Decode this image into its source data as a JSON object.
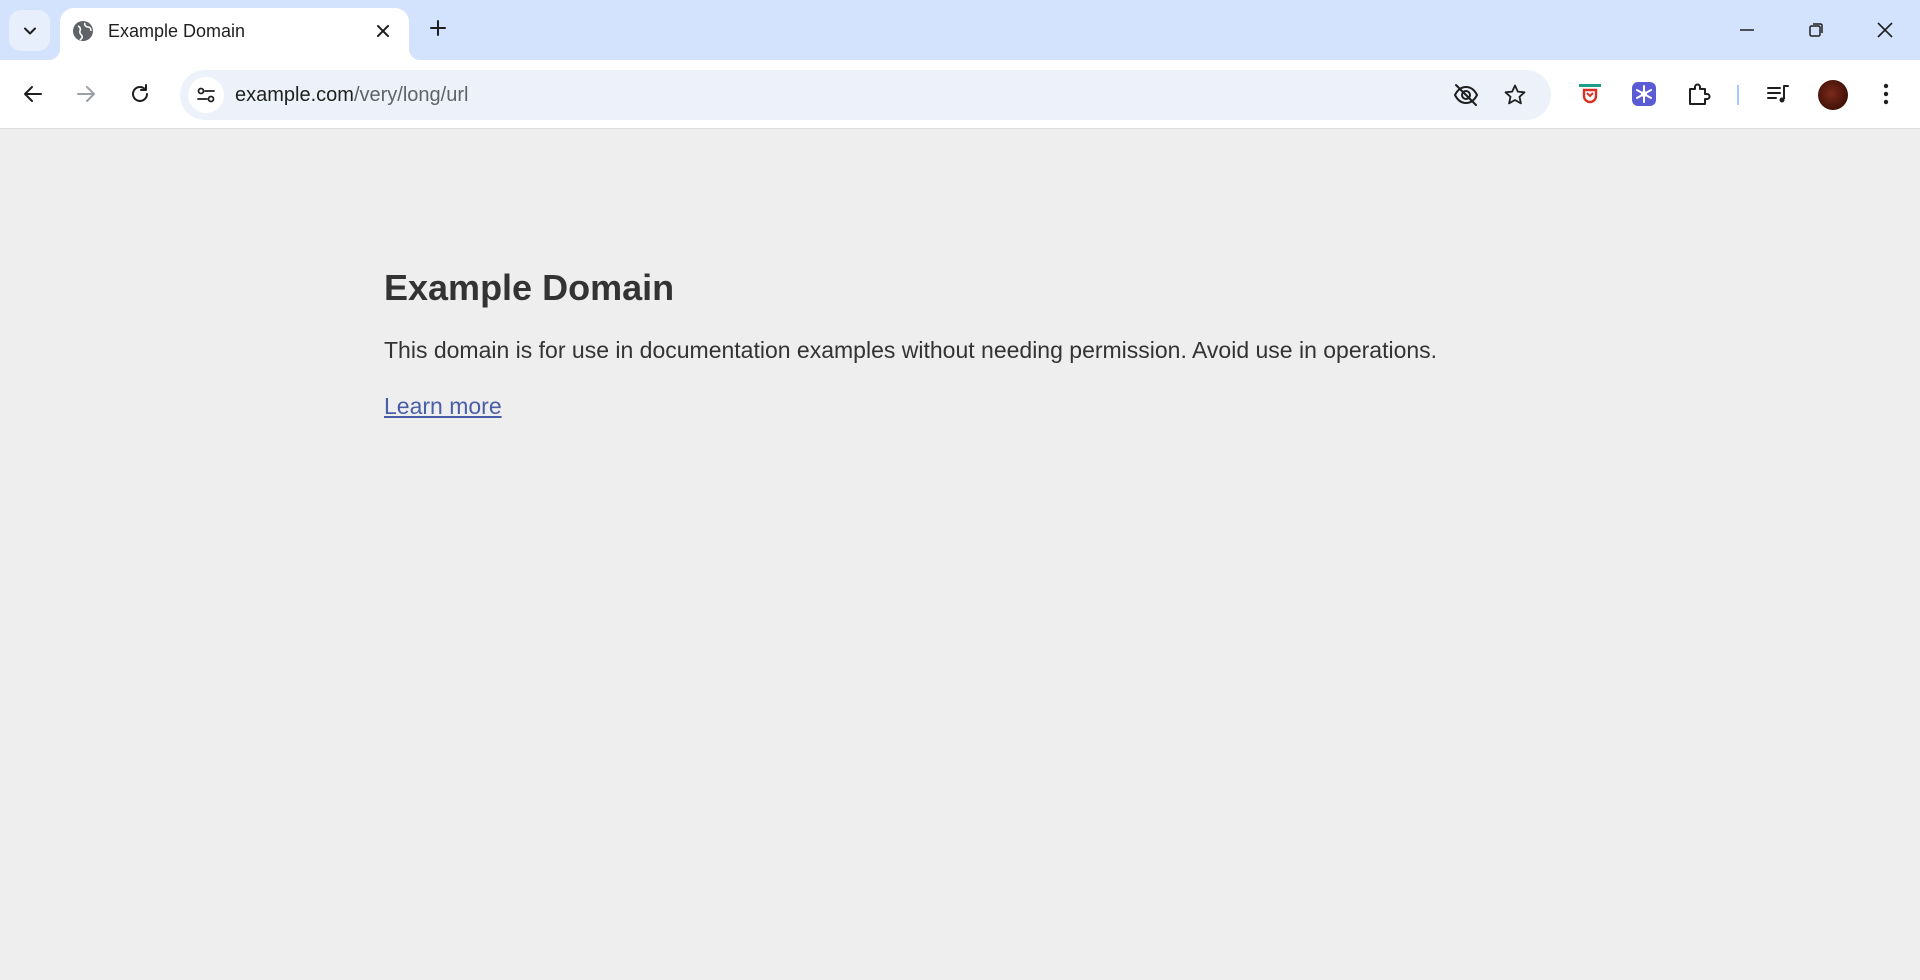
{
  "browser": {
    "tab": {
      "title": "Example Domain",
      "favicon": "globe-icon"
    },
    "address_bar": {
      "host": "example.com",
      "path": "/very/long/url"
    },
    "colors": {
      "tabstrip": "#d3e3fd",
      "toolbar": "#ffffff",
      "omnibox": "#edf2fa",
      "accent": "#5b5bd6"
    }
  },
  "page": {
    "heading": "Example Domain",
    "paragraph": "This domain is for use in documentation examples without needing permission. Avoid use in operations.",
    "link_text": "Learn more",
    "colors": {
      "background": "#eeeeee",
      "text": "#333333",
      "link": "#4a5ea8"
    }
  }
}
